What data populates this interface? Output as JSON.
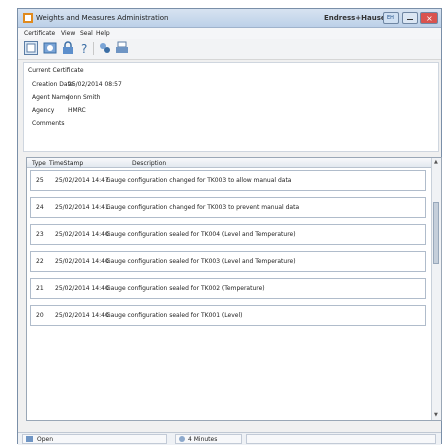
{
  "window": {
    "title": "Weights and Measures Administration",
    "brand": "Endress+Hauser",
    "brand_tag": "EH"
  },
  "menu": [
    "Certificate",
    "View",
    "Seal",
    "Help"
  ],
  "toolbar": {
    "icons": [
      "certificate-icon",
      "seal-icon",
      "lock-icon",
      "key-icon",
      "refresh-icon",
      "print-icon"
    ]
  },
  "certificate": {
    "heading": "Current Certificate",
    "creation_label": "Creation Date",
    "creation_value": "25/02/2014 08:57",
    "agent_label": "Agent Name",
    "agent_value": "Jonn Smith",
    "agency_label": "Agency",
    "agency_value": "HMRC",
    "comments_label": "Comments"
  },
  "grid": {
    "headers": [
      "Type",
      "TimeStamp",
      "Description"
    ],
    "rows": [
      {
        "type": "25",
        "timestamp": "25/02/2014 14:47",
        "description": "Gauge configuration changed for TK003 to allow manual data"
      },
      {
        "type": "24",
        "timestamp": "25/02/2014 14:41",
        "description": "Gauge configuration changed for TK003 to prevent manual data"
      },
      {
        "type": "23",
        "timestamp": "25/02/2014 14:40",
        "description": "Gauge configuration sealed for TK004 (Level and Temperature)"
      },
      {
        "type": "22",
        "timestamp": "25/02/2014 14:40",
        "description": "Gauge configuration sealed for TK003 (Level and Temperature)"
      },
      {
        "type": "21",
        "timestamp": "25/02/2014 14:40",
        "description": "Gauge configuration sealed for TK002 (Temperature)"
      },
      {
        "type": "20",
        "timestamp": "25/02/2014 14:40",
        "description": "Gauge configuration sealed for TK001 (Level)"
      }
    ]
  },
  "status": {
    "open_label": "Open",
    "timer_label": "4 Minutes"
  },
  "colors": {
    "titlebar": "#c5d6ea",
    "close": "#d9534f",
    "accent": "#3b6ea5"
  }
}
